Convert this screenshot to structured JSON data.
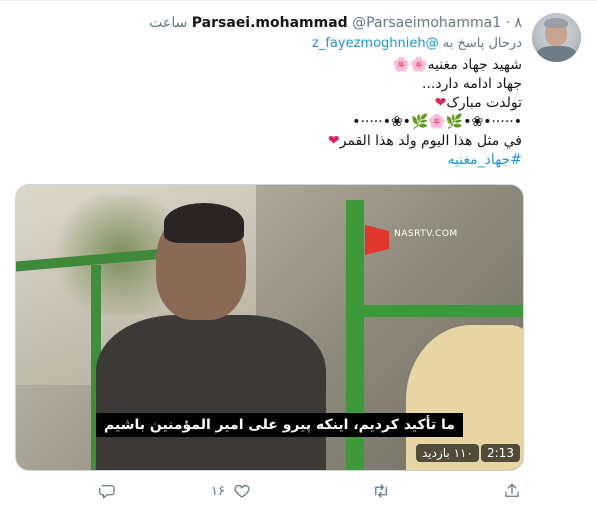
{
  "author": {
    "name": "Parsaei.mohammad",
    "handle": "@Parsaeimohamma1",
    "dot": "·",
    "time": "۸ ساعت"
  },
  "reply_to": {
    "prefix": "درحال پاسخ به",
    "mention": "@z_fayezmoghnieh"
  },
  "text": {
    "line1": "شهید جهاد مغنیه",
    "line1_emoji": "🌸🌸",
    "line2": "جهاد ادامه دارد...",
    "line3": "تولدت مبارک",
    "line3_emoji": "❤",
    "line4": "•·····•❀•🌿🌸🌿•❀•·····•",
    "line5": "في مثل هذا اليوم ولد هذا القمر",
    "line5_emoji": "❤",
    "hashtag": "#جهاد_مغنيه"
  },
  "media": {
    "watermark": "NASRTV.COM",
    "subtitle": "ما تأکید کردیم، اینکه پیرو علی امیر المؤمنین باشیم",
    "views": "۱۱۰ بازدید",
    "duration": "2:13"
  },
  "actions": {
    "reply_icon": "reply-icon",
    "like_icon": "heart-icon",
    "like_count": "۱۶",
    "retweet_icon": "retweet-icon",
    "share_icon": "share-icon"
  },
  "colors": {
    "link": "#1b95e0",
    "muted": "#657786",
    "heart": "#e0245e"
  }
}
